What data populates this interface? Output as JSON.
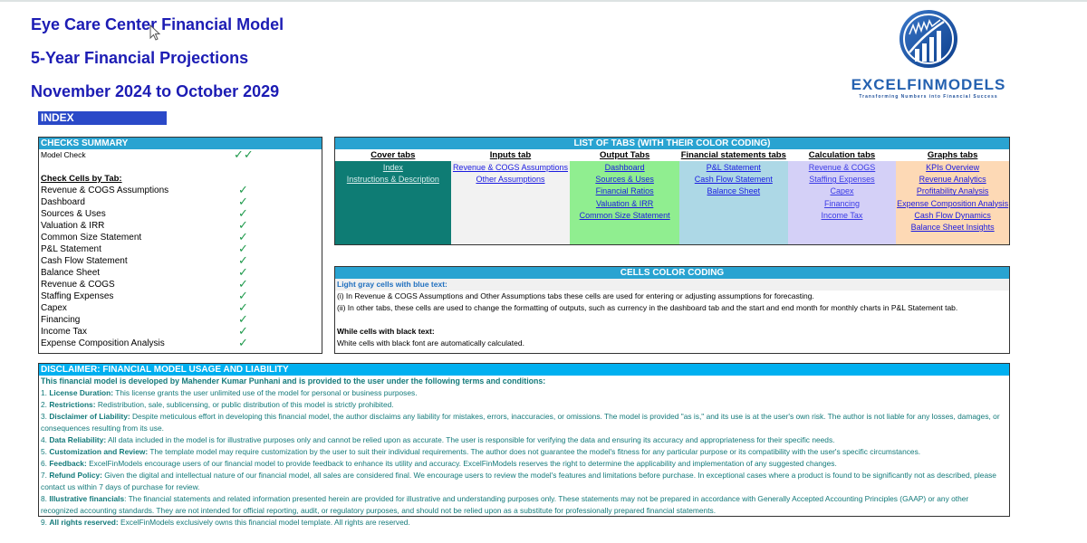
{
  "header": {
    "title": "Eye Care Center Financial Model",
    "subtitle": "5-Year Financial Projections",
    "period": "November 2024 to October 2029",
    "index_label": "INDEX"
  },
  "logo": {
    "brand": "EXCELFINMODELS",
    "tagline": "Transforming Numbers into Financial Success",
    "color": "#2461b0"
  },
  "checks": {
    "title": "CHECKS  SUMMARY",
    "model_check": {
      "label": "Model Check",
      "mark": "✓✓"
    },
    "subheading": "Check Cells by Tab:",
    "items": [
      {
        "label": "Revenue & COGS Assumptions",
        "mark": "✓"
      },
      {
        "label": "Dashboard",
        "mark": "✓"
      },
      {
        "label": "Sources & Uses",
        "mark": "✓"
      },
      {
        "label": "Valuation & IRR",
        "mark": "✓"
      },
      {
        "label": "Common Size Statement",
        "mark": "✓"
      },
      {
        "label": "P&L Statement",
        "mark": "✓"
      },
      {
        "label": "Cash Flow Statement",
        "mark": "✓"
      },
      {
        "label": "Balance Sheet",
        "mark": "✓"
      },
      {
        "label": "Revenue & COGS",
        "mark": "✓"
      },
      {
        "label": "Staffing Expenses",
        "mark": "✓"
      },
      {
        "label": "Capex",
        "mark": "✓"
      },
      {
        "label": "Financing",
        "mark": "✓"
      },
      {
        "label": "Income Tax",
        "mark": "✓"
      },
      {
        "label": "Expense Composition Analysis",
        "mark": "✓"
      }
    ]
  },
  "tabs_list": {
    "title": "LIST OF TABS (WITH THEIR COLOR CODING)",
    "columns": [
      {
        "heading": "Cover tabs",
        "color": "#0e7c74",
        "links": [
          "Index",
          "Instructions & Description"
        ]
      },
      {
        "heading": "Inputs tab",
        "color": "#f2f2f2",
        "links": [
          "Revenue & COGS Assumptions",
          "Other Assumptions"
        ]
      },
      {
        "heading": "Output Tabs",
        "color": "#90ee90",
        "links": [
          "Dashboard",
          "Sources & Uses",
          "Financial Ratios",
          "Valuation & IRR",
          "Common Size Statement"
        ]
      },
      {
        "heading": "Financial statements tabs",
        "color": "#add8e6",
        "links": [
          "P&L Statement",
          "Cash Flow Statement",
          "Balance Sheet"
        ]
      },
      {
        "heading": "Calculation tabs",
        "color": "#d4d0f7",
        "links": [
          "Revenue & COGS",
          "Staffing Expenses",
          "Capex",
          "Financing",
          "Income Tax"
        ]
      },
      {
        "heading": "Graphs tabs",
        "color": "#fdd9b5",
        "links": [
          "KPIs Overview",
          "Revenue Analytics",
          "Profitability Analysis",
          "Expense Composition Analysis",
          "Cash Flow Dynamics",
          "Balance Sheet Insights"
        ]
      }
    ]
  },
  "color_coding": {
    "title": "CELLS COLOR CODING",
    "blue_heading": "Light gray cells with blue text:",
    "blue_line1": "(i) In Revenue & COGS Assumptions and Other Assumptions tabs these cells are used for entering or adjusting assumptions for forecasting.",
    "blue_line2": "(ii) In other tabs, these cells are used to change the formatting of outputs, such as currency in the dashboard tab and the start and end month for monthly charts in P&L Statement tab.",
    "black_heading": "While cells with black text:",
    "black_line": "White cells with black font are automatically calculated."
  },
  "disclaimer": {
    "title": "DISCLAIMER: FINANCIAL MODEL USAGE AND LIABILITY",
    "intro": "This financial model  is developed by Mahender Kumar Punhani and is provided to the user under the following terms and conditions:",
    "items": [
      {
        "num": "1. ",
        "bold": "License Duration:",
        "text": " This license grants the user unlimited use of the model for personal or business purposes."
      },
      {
        "num": "2. ",
        "bold": "Restrictions:",
        "text": " Redistribution, sale, sublicensing, or public distribution of this model is strictly prohibited."
      },
      {
        "num": "3. ",
        "bold": "Disclaimer of Liability:",
        "text": " Despite meticulous effort in developing this financial model, the author disclaims any liability for mistakes, errors, inaccuracies, or omissions. The model is provided \"as is,\" and its use is at the user's own risk. The author is  not liable for any  losses, damages, or consequences resulting from its use."
      },
      {
        "num": "4. ",
        "bold": "Data Reliability:",
        "text": " All data included in the model is for illustrative purposes only and cannot be relied upon as accurate. The user is  responsible for verifying the data and ensuring its accuracy and appropriateness for their specific needs."
      },
      {
        "num": "5. ",
        "bold": "Customization and Review:",
        "text": " The template model may require customization by the user to suit their individual requirements. The author does not guarantee the model's fitness for any  particular purpose or its compatibility with the user's specific circumstances."
      },
      {
        "num": "6. ",
        "bold": "Feedback:",
        "text": " ExcelFinModels encourage users of our financial model to provide feedback to enhance its utility and accuracy. ExcelFinModels reserves the right to determine the applicability and implementation of any suggested changes."
      },
      {
        "num": "7. ",
        "bold": "Refund Policy:",
        "text": " Given the digital and intellectual nature of our financial model, all sales are considered final. We encourage users to review the model's features and limitations before purchase. In exceptional cases where a product is found to be  significantly not as described, please contact us within 7 days of purchase for review."
      },
      {
        "num": "8. ",
        "bold": "Illustrative financials",
        "text": ": The financial statements and related information presented herein are provided for illustrative and understanding purposes only. These statements may not be prepared in accordance with Generally Accepted Accounting Principles (GAAP) or any other  recognized accounting standards. They are not intended for official reporting, audit, or regulatory purposes, and should not be relied upon as a substitute for professionally prepared financial statements."
      },
      {
        "num": "9. ",
        "bold": "All rights reserved:",
        "text": " ExcelFinModels exclusively owns this financial model template. All rights are reserved."
      }
    ]
  }
}
